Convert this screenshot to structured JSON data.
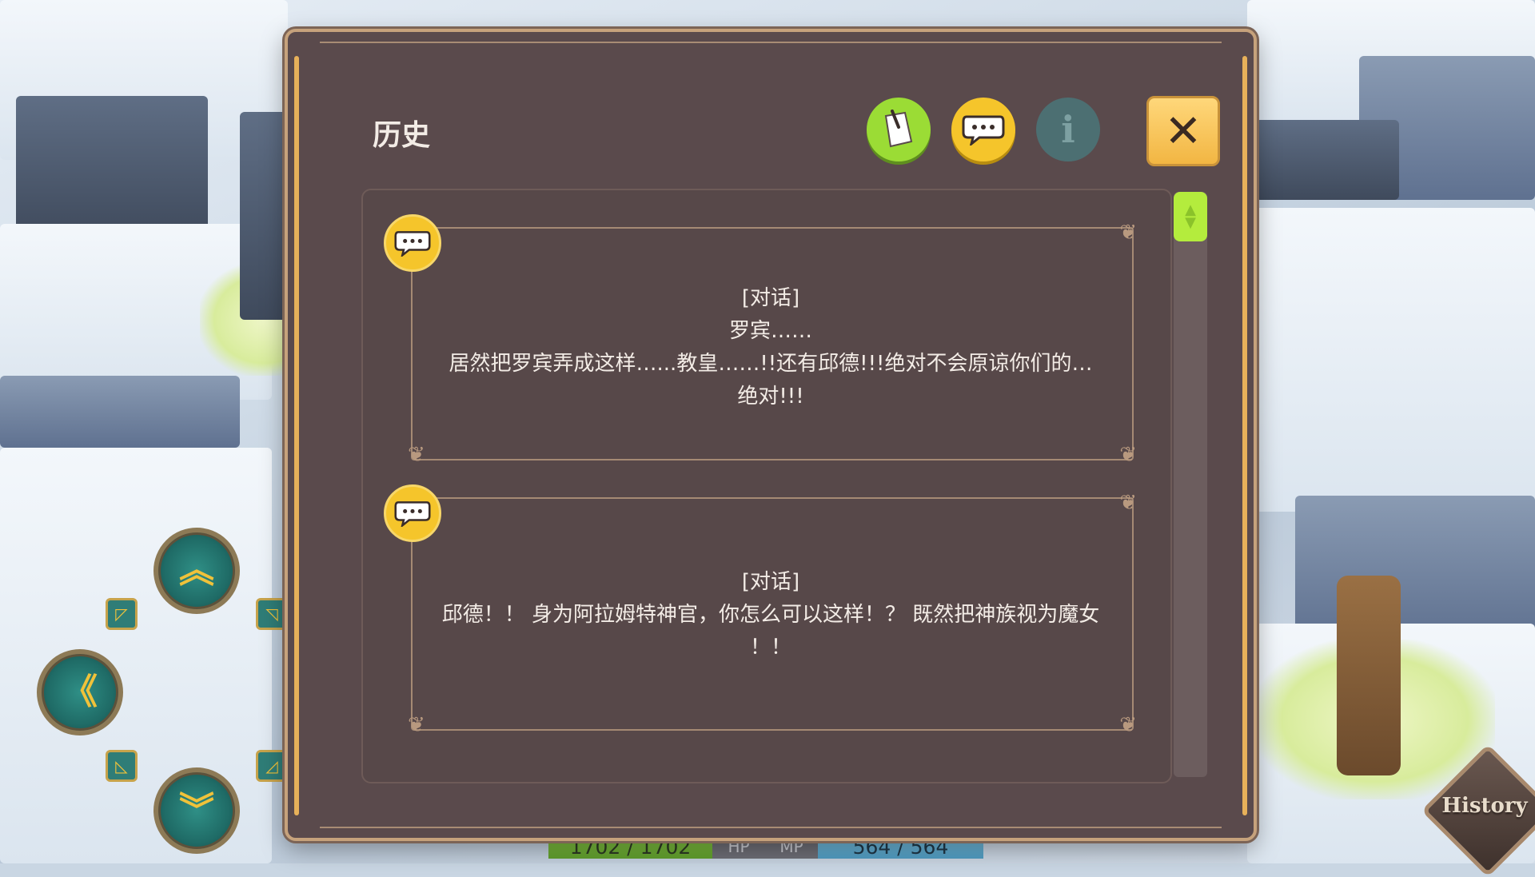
{
  "panel": {
    "title": "历史",
    "tabs": [
      {
        "name": "log",
        "icon": "note-icon"
      },
      {
        "name": "dialogue",
        "icon": "speech-bubble-icon"
      },
      {
        "name": "info",
        "icon": "info-icon",
        "glyph": "i"
      }
    ],
    "close_glyph": "✕"
  },
  "entries": [
    {
      "icon": "speech-bubble-icon",
      "lines": [
        "[对话]",
        "罗宾……",
        "居然把罗宾弄成这样…...教皇……!!还有邱德!!!绝对不会原谅你们的…",
        "绝对!!!"
      ]
    },
    {
      "icon": "speech-bubble-icon",
      "lines": [
        "[对话]",
        "邱德！！ 身为阿拉姆特神官，你怎么可以这样！？ 既然把神族视为魔女",
        "！！"
      ]
    }
  ],
  "status": {
    "hp_value": "1702 / 1702",
    "hp_label": "HP",
    "mp_label": "MP",
    "mp_value": "564 / 564"
  },
  "history_button": {
    "label": "History"
  },
  "colors": {
    "panel_bg": "#5a4a4c",
    "accent_gold": "#e7b15a",
    "active_tab": "#9bdc35",
    "bubble_yellow": "#f5c52b",
    "close_button": "#f2b643"
  }
}
